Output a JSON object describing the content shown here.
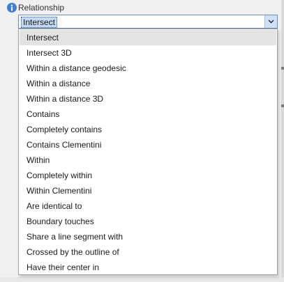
{
  "label": {
    "icon": "info-icon",
    "text": "Relationship"
  },
  "combo": {
    "value": "Intersect",
    "button_icon": "chevron-down-icon"
  },
  "dropdown": {
    "selected_index": 0,
    "items": [
      "Intersect",
      "Intersect 3D",
      "Within a distance geodesic",
      "Within a distance",
      "Within a distance 3D",
      "Contains",
      "Completely contains",
      "Contains Clementini",
      "Within",
      "Completely within",
      "Within Clementini",
      "Are identical to",
      "Boundary touches",
      "Share a line segment with",
      "Crossed by the outline of",
      "Have their center in"
    ]
  },
  "colors": {
    "info_icon": "#3f7fcf",
    "combo_border": "#6d8fbf",
    "combo_selection": "#c4d9f3",
    "selected_item": "#e3e3e3"
  }
}
